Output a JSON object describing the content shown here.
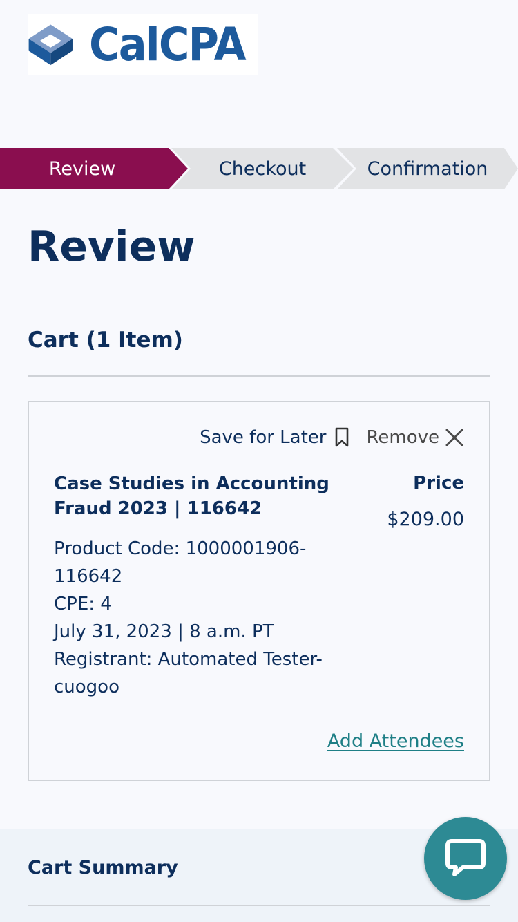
{
  "brand": {
    "name": "CalCPA"
  },
  "steps": [
    {
      "label": "Review",
      "active": true
    },
    {
      "label": "Checkout",
      "active": false
    },
    {
      "label": "Confirmation",
      "active": false
    }
  ],
  "page": {
    "title": "Review"
  },
  "cart": {
    "title": "Cart (1 Item)",
    "item": {
      "save_label": "Save for Later",
      "remove_label": "Remove",
      "title": "Case Studies in Accounting Fraud 2023 | 116642",
      "price_label": "Price",
      "price": "$209.00",
      "product_code": "Product Code: 1000001906-116642",
      "cpe": "CPE: 4",
      "date": "July 31, 2023 | 8 a.m. PT",
      "registrant": "Registrant: Automated Tester-cuogoo",
      "add_attendees_label": "Add Attendees"
    }
  },
  "summary": {
    "title": "Cart Summary"
  },
  "colors": {
    "active_step": "#8a0e4f",
    "inactive_step": "#e2e3e5",
    "navy": "#0d2e5c",
    "link_teal": "#1e7f86",
    "chat_button": "#2d8a94"
  },
  "icons": {
    "save": "bookmark-icon",
    "remove": "close-icon",
    "chat": "chat-bubble-icon"
  }
}
